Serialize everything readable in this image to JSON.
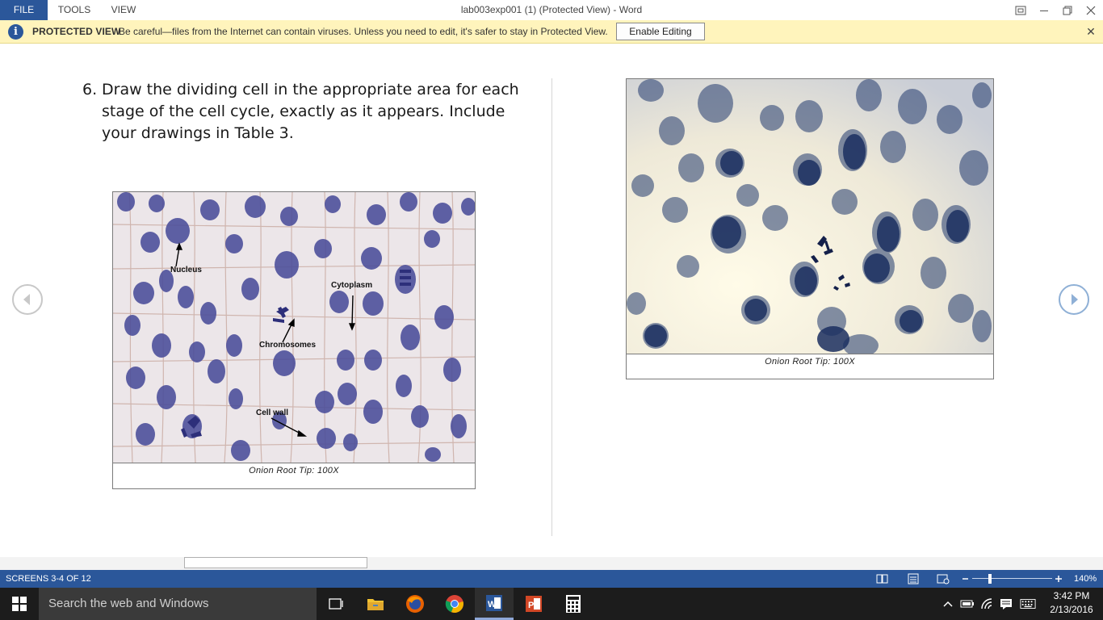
{
  "titlebar": {
    "menu": [
      "FILE",
      "TOOLS",
      "VIEW"
    ],
    "title": "lab003exp001 (1) (Protected View) - Word"
  },
  "protected_view": {
    "title": "PROTECTED VIEW",
    "message": "Be careful—files from the Internet can contain viruses. Unless you need to edit, it's safer to stay in Protected View.",
    "button": "Enable Editing",
    "close": "✕"
  },
  "document": {
    "instruction_number": "6.",
    "instruction_text": "Draw the dividing cell in the appropriate area for each stage of the cell cycle, exactly as it appears. Include your drawings in Table 3.",
    "left_figure": {
      "caption": "Onion Root Tip: 100X",
      "labels": {
        "nucleus": "Nucleus",
        "cytoplasm": "Cytoplasm",
        "chromosomes": "Chromosomes",
        "cell_wall": "Cell wall"
      }
    },
    "right_figure": {
      "caption": "Onion Root Tip: 100X"
    }
  },
  "statusbar": {
    "screens": "SCREENS 3-4 OF 12",
    "zoom": "140%",
    "zoom_fraction": 0.4
  },
  "taskbar": {
    "search_placeholder": "Search the web and Windows",
    "time": "3:42 PM",
    "date": "2/13/2016",
    "icons": [
      "windows-logo",
      "task-view",
      "file-explorer",
      "firefox",
      "chrome",
      "word",
      "powerpoint",
      "calculator"
    ]
  },
  "colors": {
    "word_blue": "#2b579a",
    "protected_bar": "#fff4bc",
    "taskbar": "#1c1c1c"
  }
}
